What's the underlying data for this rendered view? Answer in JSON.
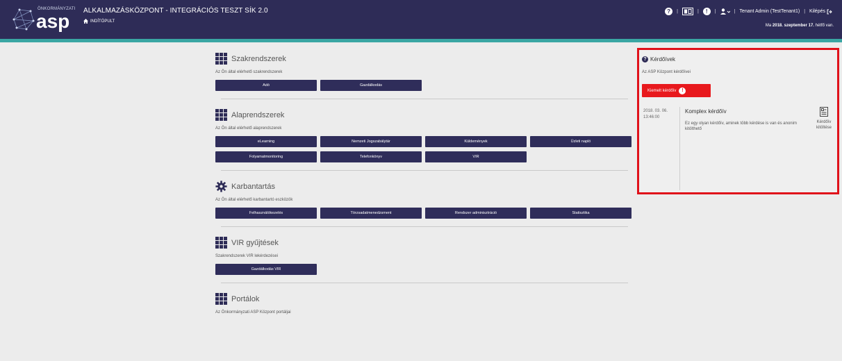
{
  "header": {
    "logo_small": "ÖNKORMÁNYZATI",
    "logo_big": "asp",
    "app_title": "ALKALMAZÁSKÖZPONT - INTEGRÁCIÓS TESZT SÍK 2.0",
    "breadcrumb": "INDÍTÓPULT",
    "user": "Tenant Admin (TestTenant1)",
    "logout": "Kilépés",
    "date_prefix": "Ma",
    "date_bold": "2018. szeptember 17.",
    "date_suffix": "hétfő van."
  },
  "sections": [
    {
      "title": "Szakrendszerek",
      "desc": "Az Ön által elérhető szakrendszerek",
      "icon": "grid-icon",
      "buttons": [
        "Adó",
        "Gazdálkodás"
      ]
    },
    {
      "title": "Alaprendszerek",
      "desc": "Az Ön által elérhető alaprendszerek",
      "icon": "grid-icon",
      "buttons": [
        "eLearning",
        "Nemzeti Jogszabálytár",
        "Küldemények",
        "Üzleti napló",
        "Folyamatmonitoring",
        "Telefonkönyv",
        "VIR"
      ]
    },
    {
      "title": "Karbantartás",
      "desc": "Az Ön által elérhető karbantartó eszközök",
      "icon": "gear-icon",
      "buttons": [
        "Felhasználókezelés",
        "Törzsadatmenedzsment",
        "Rendszer adminisztráció",
        "Statisztika"
      ]
    },
    {
      "title": "VIR gyűjtések",
      "desc": "Szakrendszerek VIR lekérdezései",
      "icon": "grid-icon",
      "buttons": [
        "Gazdálkodás VIR"
      ]
    },
    {
      "title": "Portálok",
      "desc": "Az Önkormányzati ASP Központ portáljai",
      "icon": "grid-icon",
      "buttons": []
    }
  ],
  "panel": {
    "title": "Kérdőívek",
    "desc": "Az ASP Központ kérdőívei",
    "button": "Kiemelt kérdőív",
    "date": "2018. 03. 06. 13:46:00",
    "item_title": "Komplex kérdőív",
    "item_text": "Ez egy olyan kérdőív, aminek több kérdése is van és anonim kitölthető",
    "action": "Kérdőív kitöltése"
  },
  "colors": {
    "header_bg": "#2e2c57",
    "accent_teal": "#3aa6a3",
    "button_bg": "#2f2d5a",
    "highlight_red": "#e0111a"
  }
}
